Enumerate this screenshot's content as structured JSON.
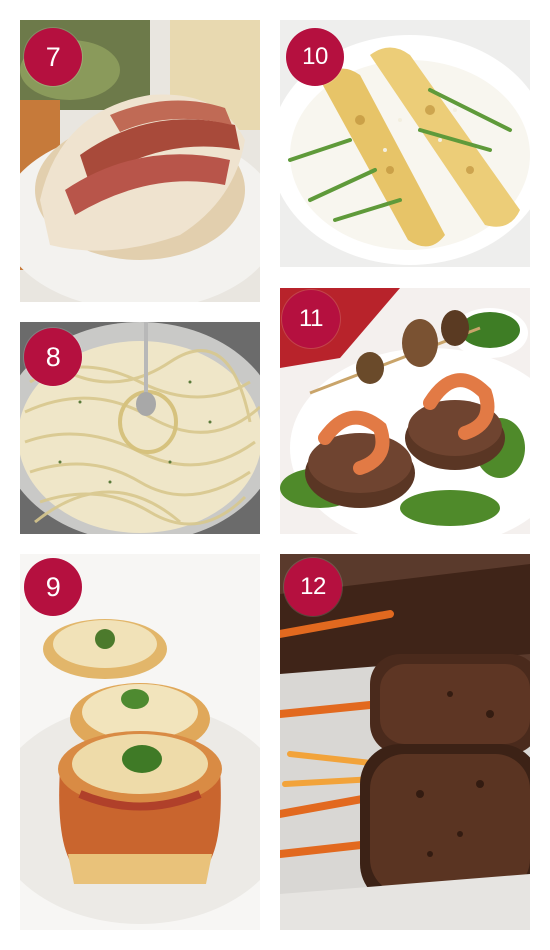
{
  "collage": {
    "accent_color": "#b5103f",
    "items": [
      {
        "number": "7",
        "photo": "bacon-wrapped-chicken-breast"
      },
      {
        "number": "8",
        "photo": "creamy-fettuccine-pasta-with-fork"
      },
      {
        "number": "9",
        "photo": "mini-lasagna-cups"
      },
      {
        "number": "10",
        "photo": "crepes-with-asparagus"
      },
      {
        "number": "11",
        "photo": "filet-with-grilled-shrimp-and-mushroom-skewer"
      },
      {
        "number": "12",
        "photo": "glazed-beef-rolls-with-vegetables"
      }
    ]
  }
}
